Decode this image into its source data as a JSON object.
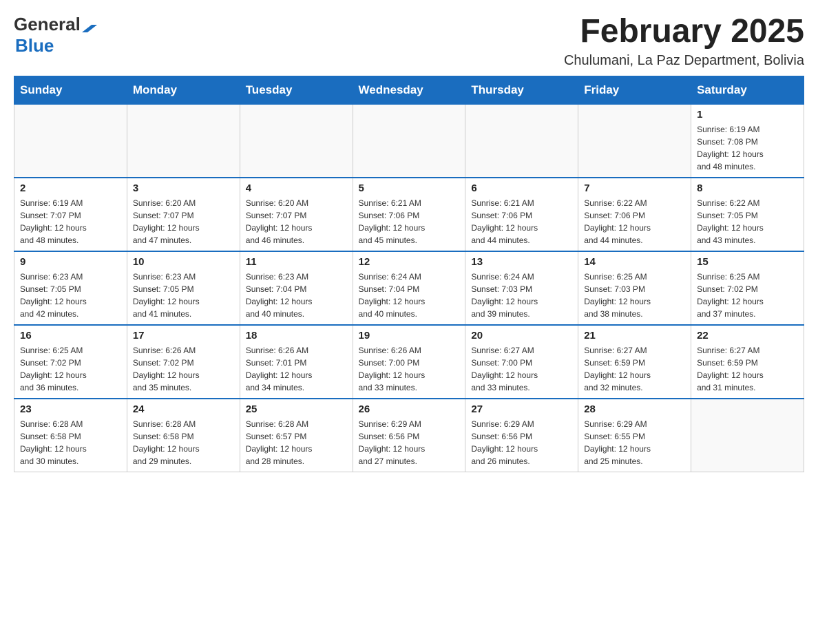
{
  "header": {
    "logo_general": "General",
    "logo_blue": "Blue",
    "month_title": "February 2025",
    "location": "Chulumani, La Paz Department, Bolivia"
  },
  "days_of_week": [
    "Sunday",
    "Monday",
    "Tuesday",
    "Wednesday",
    "Thursday",
    "Friday",
    "Saturday"
  ],
  "weeks": [
    {
      "days": [
        {
          "number": "",
          "info": ""
        },
        {
          "number": "",
          "info": ""
        },
        {
          "number": "",
          "info": ""
        },
        {
          "number": "",
          "info": ""
        },
        {
          "number": "",
          "info": ""
        },
        {
          "number": "",
          "info": ""
        },
        {
          "number": "1",
          "info": "Sunrise: 6:19 AM\nSunset: 7:08 PM\nDaylight: 12 hours\nand 48 minutes."
        }
      ]
    },
    {
      "days": [
        {
          "number": "2",
          "info": "Sunrise: 6:19 AM\nSunset: 7:07 PM\nDaylight: 12 hours\nand 48 minutes."
        },
        {
          "number": "3",
          "info": "Sunrise: 6:20 AM\nSunset: 7:07 PM\nDaylight: 12 hours\nand 47 minutes."
        },
        {
          "number": "4",
          "info": "Sunrise: 6:20 AM\nSunset: 7:07 PM\nDaylight: 12 hours\nand 46 minutes."
        },
        {
          "number": "5",
          "info": "Sunrise: 6:21 AM\nSunset: 7:06 PM\nDaylight: 12 hours\nand 45 minutes."
        },
        {
          "number": "6",
          "info": "Sunrise: 6:21 AM\nSunset: 7:06 PM\nDaylight: 12 hours\nand 44 minutes."
        },
        {
          "number": "7",
          "info": "Sunrise: 6:22 AM\nSunset: 7:06 PM\nDaylight: 12 hours\nand 44 minutes."
        },
        {
          "number": "8",
          "info": "Sunrise: 6:22 AM\nSunset: 7:05 PM\nDaylight: 12 hours\nand 43 minutes."
        }
      ]
    },
    {
      "days": [
        {
          "number": "9",
          "info": "Sunrise: 6:23 AM\nSunset: 7:05 PM\nDaylight: 12 hours\nand 42 minutes."
        },
        {
          "number": "10",
          "info": "Sunrise: 6:23 AM\nSunset: 7:05 PM\nDaylight: 12 hours\nand 41 minutes."
        },
        {
          "number": "11",
          "info": "Sunrise: 6:23 AM\nSunset: 7:04 PM\nDaylight: 12 hours\nand 40 minutes."
        },
        {
          "number": "12",
          "info": "Sunrise: 6:24 AM\nSunset: 7:04 PM\nDaylight: 12 hours\nand 40 minutes."
        },
        {
          "number": "13",
          "info": "Sunrise: 6:24 AM\nSunset: 7:03 PM\nDaylight: 12 hours\nand 39 minutes."
        },
        {
          "number": "14",
          "info": "Sunrise: 6:25 AM\nSunset: 7:03 PM\nDaylight: 12 hours\nand 38 minutes."
        },
        {
          "number": "15",
          "info": "Sunrise: 6:25 AM\nSunset: 7:02 PM\nDaylight: 12 hours\nand 37 minutes."
        }
      ]
    },
    {
      "days": [
        {
          "number": "16",
          "info": "Sunrise: 6:25 AM\nSunset: 7:02 PM\nDaylight: 12 hours\nand 36 minutes."
        },
        {
          "number": "17",
          "info": "Sunrise: 6:26 AM\nSunset: 7:02 PM\nDaylight: 12 hours\nand 35 minutes."
        },
        {
          "number": "18",
          "info": "Sunrise: 6:26 AM\nSunset: 7:01 PM\nDaylight: 12 hours\nand 34 minutes."
        },
        {
          "number": "19",
          "info": "Sunrise: 6:26 AM\nSunset: 7:00 PM\nDaylight: 12 hours\nand 33 minutes."
        },
        {
          "number": "20",
          "info": "Sunrise: 6:27 AM\nSunset: 7:00 PM\nDaylight: 12 hours\nand 33 minutes."
        },
        {
          "number": "21",
          "info": "Sunrise: 6:27 AM\nSunset: 6:59 PM\nDaylight: 12 hours\nand 32 minutes."
        },
        {
          "number": "22",
          "info": "Sunrise: 6:27 AM\nSunset: 6:59 PM\nDaylight: 12 hours\nand 31 minutes."
        }
      ]
    },
    {
      "days": [
        {
          "number": "23",
          "info": "Sunrise: 6:28 AM\nSunset: 6:58 PM\nDaylight: 12 hours\nand 30 minutes."
        },
        {
          "number": "24",
          "info": "Sunrise: 6:28 AM\nSunset: 6:58 PM\nDaylight: 12 hours\nand 29 minutes."
        },
        {
          "number": "25",
          "info": "Sunrise: 6:28 AM\nSunset: 6:57 PM\nDaylight: 12 hours\nand 28 minutes."
        },
        {
          "number": "26",
          "info": "Sunrise: 6:29 AM\nSunset: 6:56 PM\nDaylight: 12 hours\nand 27 minutes."
        },
        {
          "number": "27",
          "info": "Sunrise: 6:29 AM\nSunset: 6:56 PM\nDaylight: 12 hours\nand 26 minutes."
        },
        {
          "number": "28",
          "info": "Sunrise: 6:29 AM\nSunset: 6:55 PM\nDaylight: 12 hours\nand 25 minutes."
        },
        {
          "number": "",
          "info": ""
        }
      ]
    }
  ]
}
